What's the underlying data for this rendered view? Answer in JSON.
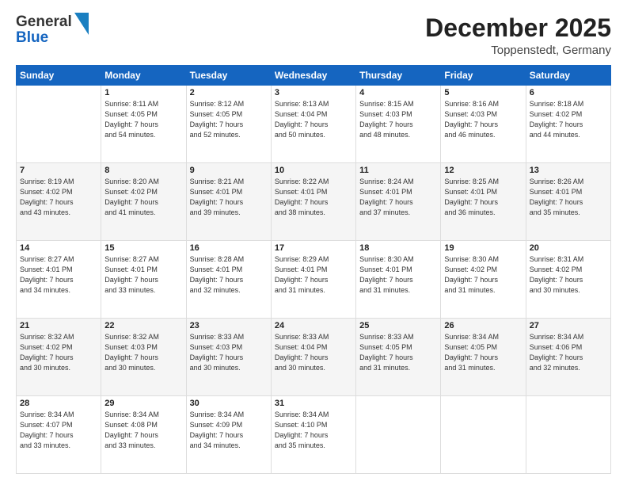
{
  "header": {
    "logo_line1": "General",
    "logo_line2": "Blue",
    "month": "December 2025",
    "location": "Toppenstedt, Germany"
  },
  "weekdays": [
    "Sunday",
    "Monday",
    "Tuesday",
    "Wednesday",
    "Thursday",
    "Friday",
    "Saturday"
  ],
  "weeks": [
    [
      {
        "day": "",
        "info": ""
      },
      {
        "day": "1",
        "info": "Sunrise: 8:11 AM\nSunset: 4:05 PM\nDaylight: 7 hours\nand 54 minutes."
      },
      {
        "day": "2",
        "info": "Sunrise: 8:12 AM\nSunset: 4:05 PM\nDaylight: 7 hours\nand 52 minutes."
      },
      {
        "day": "3",
        "info": "Sunrise: 8:13 AM\nSunset: 4:04 PM\nDaylight: 7 hours\nand 50 minutes."
      },
      {
        "day": "4",
        "info": "Sunrise: 8:15 AM\nSunset: 4:03 PM\nDaylight: 7 hours\nand 48 minutes."
      },
      {
        "day": "5",
        "info": "Sunrise: 8:16 AM\nSunset: 4:03 PM\nDaylight: 7 hours\nand 46 minutes."
      },
      {
        "day": "6",
        "info": "Sunrise: 8:18 AM\nSunset: 4:02 PM\nDaylight: 7 hours\nand 44 minutes."
      }
    ],
    [
      {
        "day": "7",
        "info": ""
      },
      {
        "day": "8",
        "info": "Sunrise: 8:20 AM\nSunset: 4:02 PM\nDaylight: 7 hours\nand 41 minutes."
      },
      {
        "day": "9",
        "info": "Sunrise: 8:21 AM\nSunset: 4:01 PM\nDaylight: 7 hours\nand 39 minutes."
      },
      {
        "day": "10",
        "info": "Sunrise: 8:22 AM\nSunset: 4:01 PM\nDaylight: 7 hours\nand 38 minutes."
      },
      {
        "day": "11",
        "info": "Sunrise: 8:24 AM\nSunset: 4:01 PM\nDaylight: 7 hours\nand 37 minutes."
      },
      {
        "day": "12",
        "info": "Sunrise: 8:25 AM\nSunset: 4:01 PM\nDaylight: 7 hours\nand 36 minutes."
      },
      {
        "day": "13",
        "info": "Sunrise: 8:26 AM\nSunset: 4:01 PM\nDaylight: 7 hours\nand 35 minutes."
      }
    ],
    [
      {
        "day": "14",
        "info": ""
      },
      {
        "day": "15",
        "info": "Sunrise: 8:27 AM\nSunset: 4:01 PM\nDaylight: 7 hours\nand 33 minutes."
      },
      {
        "day": "16",
        "info": "Sunrise: 8:28 AM\nSunset: 4:01 PM\nDaylight: 7 hours\nand 32 minutes."
      },
      {
        "day": "17",
        "info": "Sunrise: 8:29 AM\nSunset: 4:01 PM\nDaylight: 7 hours\nand 31 minutes."
      },
      {
        "day": "18",
        "info": "Sunrise: 8:30 AM\nSunset: 4:01 PM\nDaylight: 7 hours\nand 31 minutes."
      },
      {
        "day": "19",
        "info": "Sunrise: 8:30 AM\nSunset: 4:02 PM\nDaylight: 7 hours\nand 31 minutes."
      },
      {
        "day": "20",
        "info": "Sunrise: 8:31 AM\nSunset: 4:02 PM\nDaylight: 7 hours\nand 30 minutes."
      }
    ],
    [
      {
        "day": "21",
        "info": ""
      },
      {
        "day": "22",
        "info": "Sunrise: 8:32 AM\nSunset: 4:03 PM\nDaylight: 7 hours\nand 30 minutes."
      },
      {
        "day": "23",
        "info": "Sunrise: 8:33 AM\nSunset: 4:03 PM\nDaylight: 7 hours\nand 30 minutes."
      },
      {
        "day": "24",
        "info": "Sunrise: 8:33 AM\nSunset: 4:04 PM\nDaylight: 7 hours\nand 30 minutes."
      },
      {
        "day": "25",
        "info": "Sunrise: 8:33 AM\nSunset: 4:05 PM\nDaylight: 7 hours\nand 31 minutes."
      },
      {
        "day": "26",
        "info": "Sunrise: 8:34 AM\nSunset: 4:05 PM\nDaylight: 7 hours\nand 31 minutes."
      },
      {
        "day": "27",
        "info": "Sunrise: 8:34 AM\nSunset: 4:06 PM\nDaylight: 7 hours\nand 32 minutes."
      }
    ],
    [
      {
        "day": "28",
        "info": "Sunrise: 8:34 AM\nSunset: 4:07 PM\nDaylight: 7 hours\nand 33 minutes."
      },
      {
        "day": "29",
        "info": "Sunrise: 8:34 AM\nSunset: 4:08 PM\nDaylight: 7 hours\nand 33 minutes."
      },
      {
        "day": "30",
        "info": "Sunrise: 8:34 AM\nSunset: 4:09 PM\nDaylight: 7 hours\nand 34 minutes."
      },
      {
        "day": "31",
        "info": "Sunrise: 8:34 AM\nSunset: 4:10 PM\nDaylight: 7 hours\nand 35 minutes."
      },
      {
        "day": "",
        "info": ""
      },
      {
        "day": "",
        "info": ""
      },
      {
        "day": "",
        "info": ""
      }
    ]
  ],
  "week1_sun_info": "Sunrise: 8:19 AM\nSunset: 4:02 PM\nDaylight: 7 hours\nand 43 minutes.",
  "week3_sun_info": "Sunrise: 8:27 AM\nSunset: 4:01 PM\nDaylight: 7 hours\nand 34 minutes.",
  "week4_sun_info": "Sunrise: 8:32 AM\nSunset: 4:02 PM\nDaylight: 7 hours\nand 30 minutes."
}
